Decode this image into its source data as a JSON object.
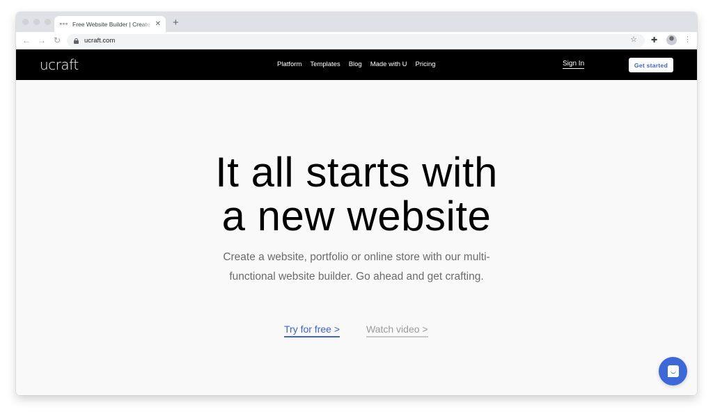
{
  "browser": {
    "tab": {
      "favicon": "ucraft-dots-icon",
      "title": "Free Website Builder | Create a Website",
      "close_glyph": "✕"
    },
    "new_tab_glyph": "+",
    "back_glyph": "←",
    "forward_glyph": "→",
    "reload_glyph": "↻",
    "url": "ucraft.com",
    "star_glyph": "☆",
    "extensions_glyph": "✚",
    "menu_glyph": "⋮"
  },
  "site": {
    "logo": "ucraft",
    "nav": [
      {
        "label": "Platform"
      },
      {
        "label": "Templates"
      },
      {
        "label": "Blog"
      },
      {
        "label": "Made with U"
      },
      {
        "label": "Pricing"
      }
    ],
    "sign_in": "Sign In",
    "get_started": "Get started"
  },
  "hero": {
    "headline_line1": "It all starts with",
    "headline_line2": "a new website",
    "subtitle_line1": "Create a website, portfolio or online store with our multi-",
    "subtitle_line2": "functional website builder. Go ahead and get crafting.",
    "try_free": "Try for free >",
    "watch_video": "Watch video >"
  },
  "colors": {
    "accent": "#3b63d8",
    "nav_bg": "#000000",
    "hero_bg": "#f9f9f9",
    "chat_bg": "#3c68d8"
  }
}
